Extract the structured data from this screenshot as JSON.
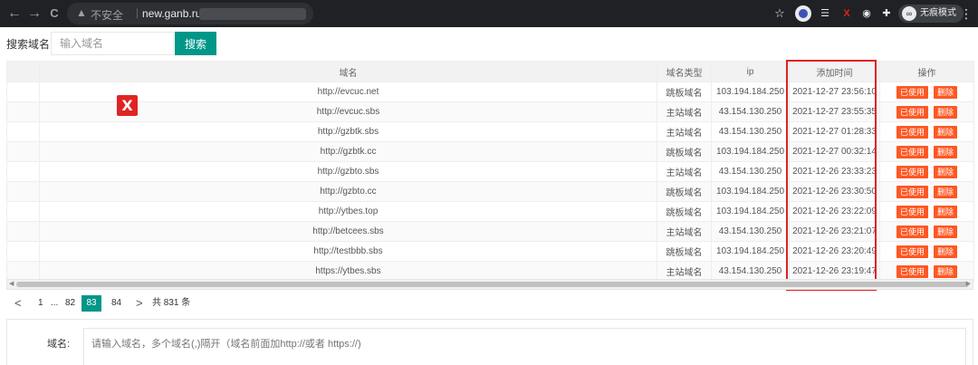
{
  "browser": {
    "back": "←",
    "forward": "→",
    "reload": "C",
    "insecure_label": "不安全",
    "separator": "|",
    "url": "new.ganb.ru",
    "incognito_label": "无痕模式",
    "menu": "⋮"
  },
  "search": {
    "label": "搜索域名:",
    "placeholder": "输入域名",
    "button": "搜索"
  },
  "table": {
    "headers": [
      "",
      "域名",
      "域名类型",
      "ip",
      "添加时间",
      "操作"
    ],
    "rows": [
      {
        "domain": "http://evcuc.net",
        "type": "跳板域名",
        "ip": "103.194.184.250",
        "time": "2021-12-27 23:56:10"
      },
      {
        "domain": "http://evcuc.sbs",
        "type": "主站域名",
        "ip": "43.154.130.250",
        "time": "2021-12-27 23:55:35"
      },
      {
        "domain": "http://gzbtk.sbs",
        "type": "主站域名",
        "ip": "43.154.130.250",
        "time": "2021-12-27 01:28:33"
      },
      {
        "domain": "http://gzbtk.cc",
        "type": "跳板域名",
        "ip": "103.194.184.250",
        "time": "2021-12-27 00:32:14"
      },
      {
        "domain": "http://gzbto.sbs",
        "type": "主站域名",
        "ip": "43.154.130.250",
        "time": "2021-12-26 23:33:23"
      },
      {
        "domain": "http://gzbto.cc",
        "type": "跳板域名",
        "ip": "103.194.184.250",
        "time": "2021-12-26 23:30:50"
      },
      {
        "domain": "http://ytbes.top",
        "type": "跳板域名",
        "ip": "103.194.184.250",
        "time": "2021-12-26 23:22:09"
      },
      {
        "domain": "http://betcees.sbs",
        "type": "主站域名",
        "ip": "43.154.130.250",
        "time": "2021-12-26 23:21:07"
      },
      {
        "domain": "http://testbbb.sbs",
        "type": "跳板域名",
        "ip": "103.194.184.250",
        "time": "2021-12-26 23:20:49"
      },
      {
        "domain": "https://ytbes.sbs",
        "type": "主站域名",
        "ip": "43.154.130.250",
        "time": "2021-12-26 23:19:47"
      }
    ],
    "used_label": "已使用",
    "delete_label": "删除"
  },
  "pagination": {
    "prev": "<",
    "first": "1",
    "ellipsis": "...",
    "p82": "82",
    "current": "83",
    "p84": "84",
    "next": ">",
    "total": "共 831 条"
  },
  "form": {
    "label": "域名:",
    "placeholder": "请输入域名，多个域名(,)隔开（域名前面加http://或者 https://)"
  },
  "overlay": {
    "x_mark": "X"
  },
  "colors": {
    "accent": "#009688",
    "danger": "#ff5722",
    "highlight": "#e02020"
  }
}
